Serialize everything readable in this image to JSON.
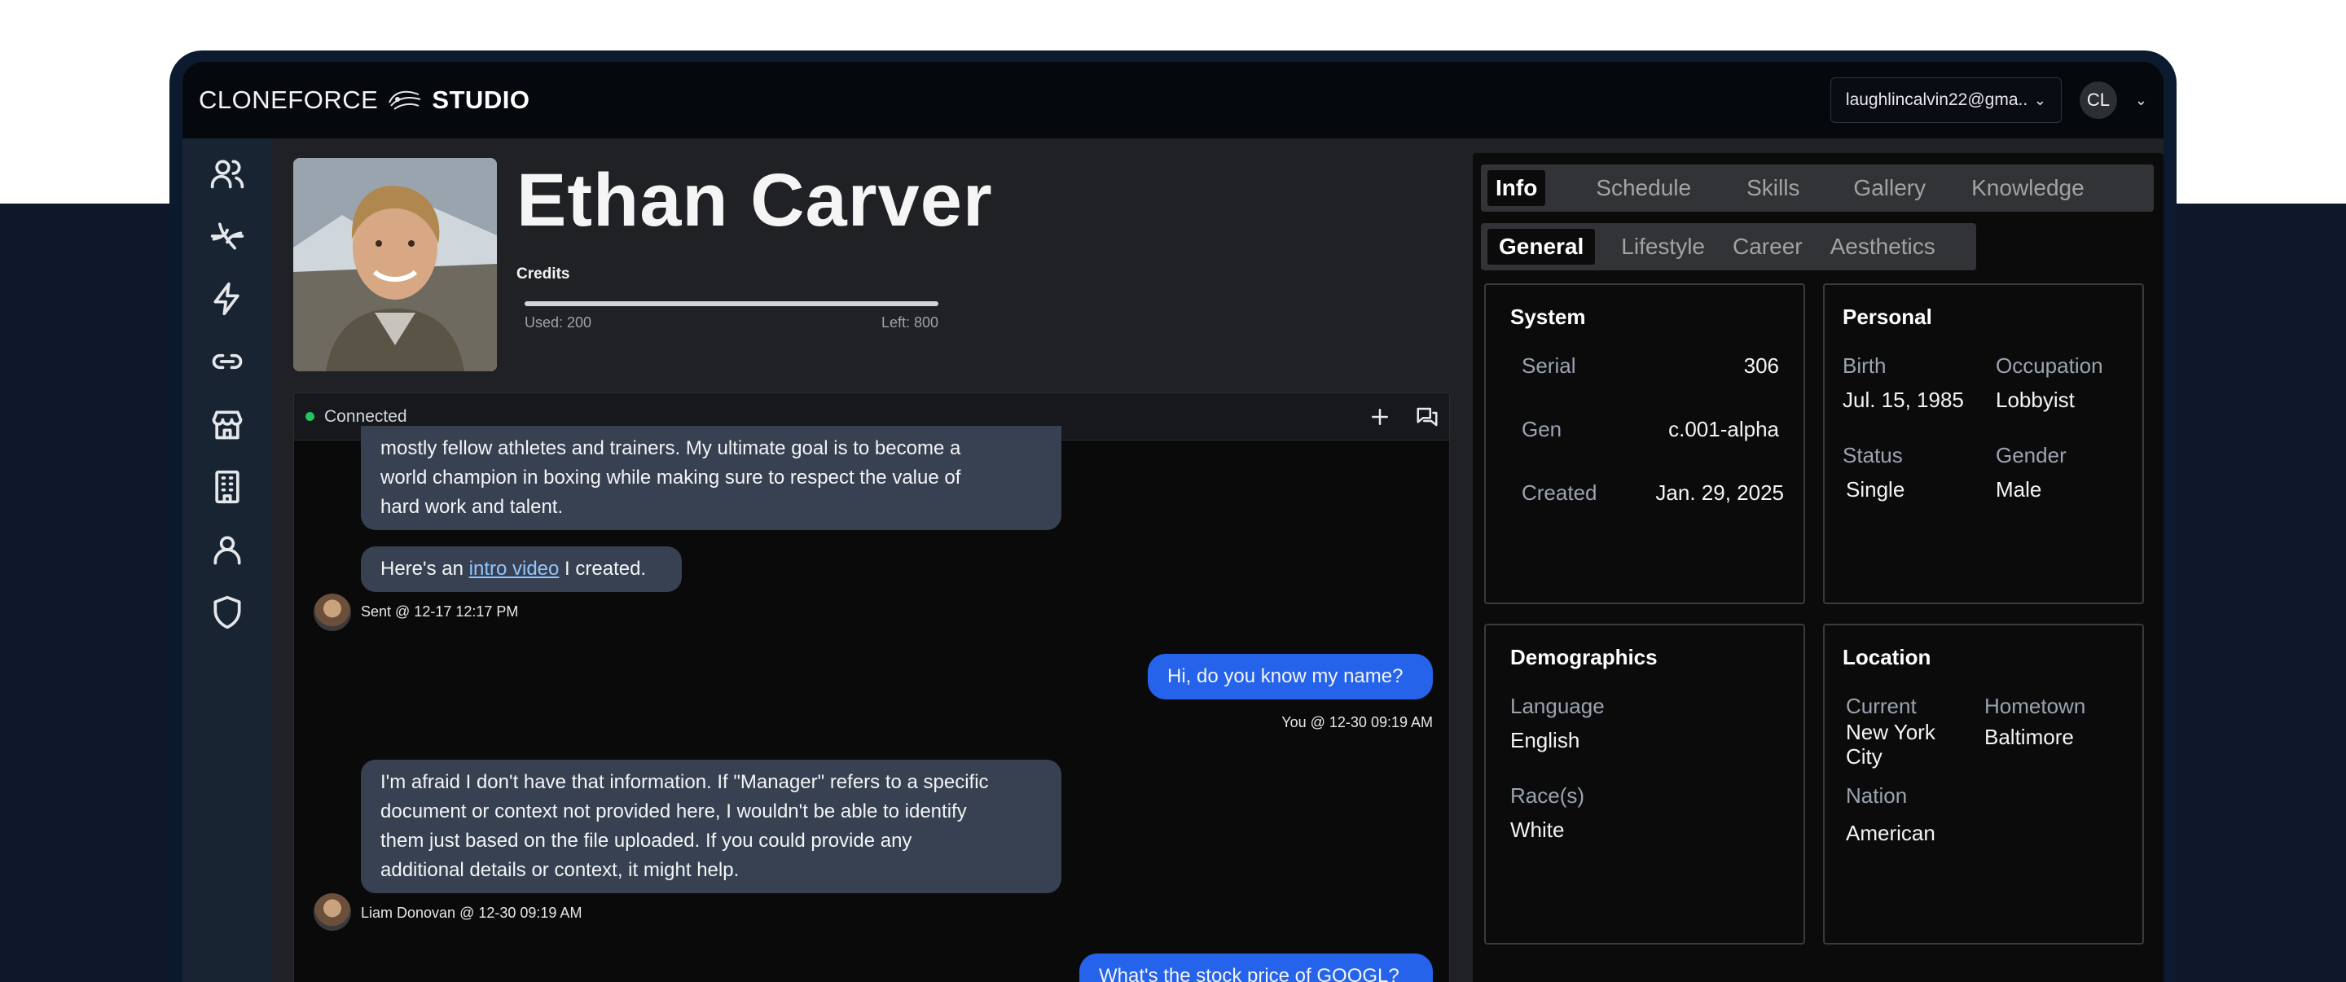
{
  "app": {
    "brand_light": "CLONEFORCE",
    "brand_bold": "STUDIO",
    "account_email": "laughlincalvin22@gma...",
    "avatar_initials": "CL"
  },
  "sidebar": {
    "items": [
      {
        "name": "users-icon"
      },
      {
        "name": "dna-icon"
      },
      {
        "name": "lightning-icon"
      },
      {
        "name": "link-icon"
      },
      {
        "name": "store-icon"
      },
      {
        "name": "building-icon"
      },
      {
        "name": "user-icon"
      },
      {
        "name": "shield-icon"
      }
    ]
  },
  "profile": {
    "name": "Ethan Carver",
    "credits_label": "Credits",
    "used": "Used: 200",
    "left": "Left: 800",
    "credits_used_fraction": 0.2
  },
  "chat": {
    "status": "Connected",
    "messages": [
      {
        "text_lines": [
          "mostly fellow athletes and trainers. My ultimate goal is to become a",
          "world champion in boxing while making sure to respect the value of",
          "hard work and talent."
        ]
      },
      {
        "prefix": "Here's an ",
        "link": "intro video",
        "suffix": " I created.",
        "meta": "Sent @ 12-17 12:17 PM"
      },
      {
        "text": "Hi, do you know my name?",
        "meta": "You @ 12-30 09:19 AM"
      },
      {
        "text_lines": [
          "I'm afraid I don't have that information. If \"Manager\" refers to a specific",
          "document or context not provided here, I wouldn't be able to identify",
          "them just based on the file uploaded. If you could provide any",
          "additional details or context, it might help."
        ],
        "meta": "Liam Donovan @ 12-30 09:19 AM"
      },
      {
        "text": "What's the stock price of GOOGL?"
      }
    ]
  },
  "tabs": {
    "main": [
      "Info",
      "Schedule",
      "Skills",
      "Gallery",
      "Knowledge"
    ],
    "sub": [
      "General",
      "Lifestyle",
      "Career",
      "Aesthetics"
    ]
  },
  "cards": {
    "system": {
      "title": "System",
      "serial_label": "Serial",
      "serial": "306",
      "gen_label": "Gen",
      "gen": "c.001-alpha",
      "created_label": "Created",
      "created": "Jan. 29, 2025"
    },
    "personal": {
      "title": "Personal",
      "birth_label": "Birth",
      "birth": "Jul. 15, 1985",
      "occupation_label": "Occupation",
      "occupation": "Lobbyist",
      "status_label": "Status",
      "status": "Single",
      "gender_label": "Gender",
      "gender": "Male"
    },
    "demographics": {
      "title": "Demographics",
      "language_label": "Language",
      "language": "English",
      "race_label": "Race(s)",
      "race": "White"
    },
    "location": {
      "title": "Location",
      "current_label": "Current",
      "current_lines": [
        "New York",
        "City"
      ],
      "hometown_label": "Hometown",
      "hometown": "Baltimore",
      "nation_label": "Nation",
      "nation": "American"
    }
  },
  "colors": {
    "accent_blue": "#2563eb",
    "bot_bubble": "#374151",
    "connected_green": "#22c55e"
  }
}
